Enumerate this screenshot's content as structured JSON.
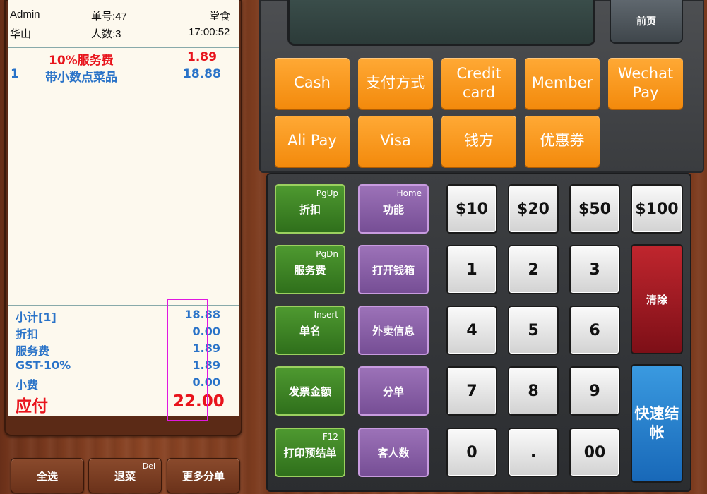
{
  "receipt": {
    "operator": "Admin",
    "order_no": "单号:47",
    "order_type": "堂食",
    "table": "华山",
    "guests": "人数:3",
    "time": "17:00:52",
    "items": [
      {
        "index": "",
        "name": "10%服务费",
        "price": "1.89",
        "color": "#e8141c"
      },
      {
        "index": "1",
        "name": "带小数点菜品",
        "price": "18.88",
        "color": "#2a73c8"
      }
    ],
    "summary": [
      {
        "label": "小计[1]",
        "value": "18.88"
      },
      {
        "label": "折扣",
        "value": "0.00"
      },
      {
        "label": "服务费",
        "value": "1.89"
      },
      {
        "label": "GST-10%",
        "value": "1.89"
      },
      {
        "label": "小费",
        "value": "0.00"
      }
    ],
    "total_label": "应付",
    "total_value": "22.00"
  },
  "bottom_buttons": {
    "select_all": "全选",
    "return_item": "退菜",
    "return_hint": "Del",
    "more_split": "更多分单"
  },
  "terminal": {
    "prev_page": "前页",
    "payments": [
      "Cash",
      "支付方式",
      "Credit card",
      "Member",
      "Wechat Pay",
      "Ali Pay",
      "Visa",
      "钱方",
      "优惠券"
    ]
  },
  "keypad": {
    "functions_left": [
      {
        "label": "折扣",
        "hint": "PgUp"
      },
      {
        "label": "服务费",
        "hint": "PgDn"
      },
      {
        "label": "单名",
        "hint": "Insert"
      },
      {
        "label": "发票金额",
        "hint": ""
      },
      {
        "label": "打印预结单",
        "hint": "F12"
      }
    ],
    "functions_right": [
      {
        "label": "功能",
        "hint": "Home"
      },
      {
        "label": "打开钱箱",
        "hint": ""
      },
      {
        "label": "外卖信息",
        "hint": ""
      },
      {
        "label": "分单",
        "hint": ""
      },
      {
        "label": "客人数",
        "hint": ""
      }
    ],
    "money": [
      "$10",
      "$20",
      "$50",
      "$100"
    ],
    "digits": [
      "1",
      "2",
      "3",
      "4",
      "5",
      "6",
      "7",
      "8",
      "9",
      "0",
      ".",
      "00"
    ],
    "clear": "清除",
    "quick_checkout": "快速结帐"
  }
}
